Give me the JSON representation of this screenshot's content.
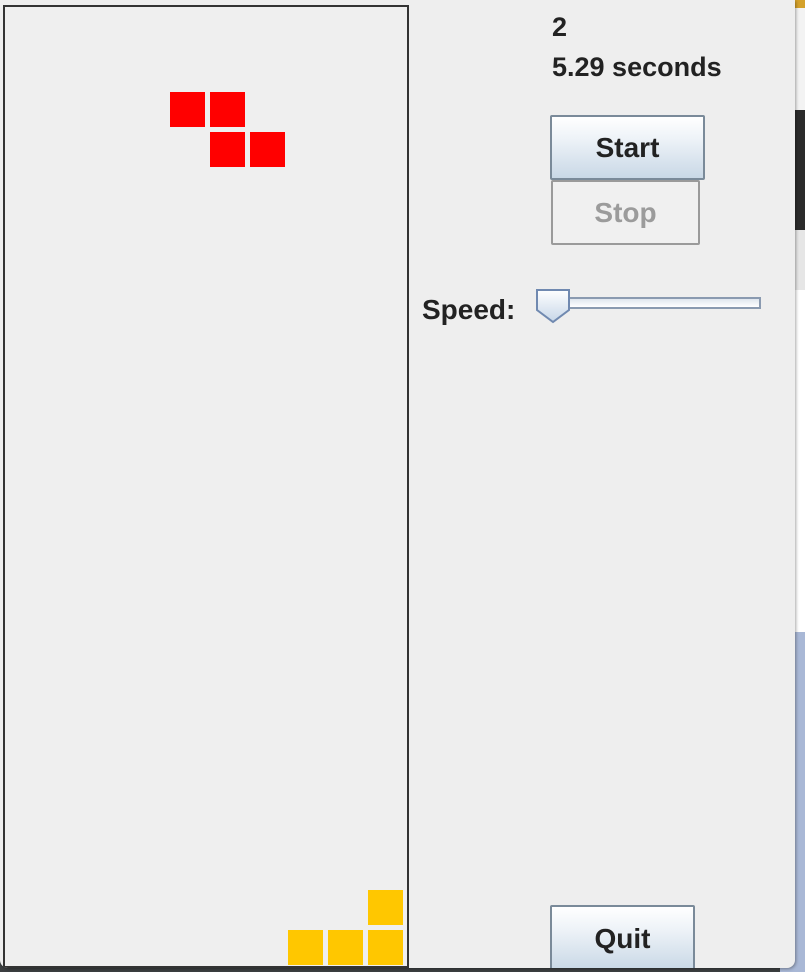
{
  "game": {
    "score": "2",
    "elapsed_time": "5.29 seconds",
    "next_piece": {
      "shape": "Z",
      "color": "#ff0000"
    },
    "landed_piece": {
      "shape": "L",
      "color": "#ffc700"
    }
  },
  "controls": {
    "start_label": "Start",
    "stop_label": "Stop",
    "quit_label": "Quit",
    "speed_label": "Speed:",
    "speed_value": 0
  },
  "colors": {
    "window_background": "#eeeeee",
    "board_border": "#333333",
    "next_piece": "#ff0000",
    "landed_piece": "#ffc700"
  }
}
